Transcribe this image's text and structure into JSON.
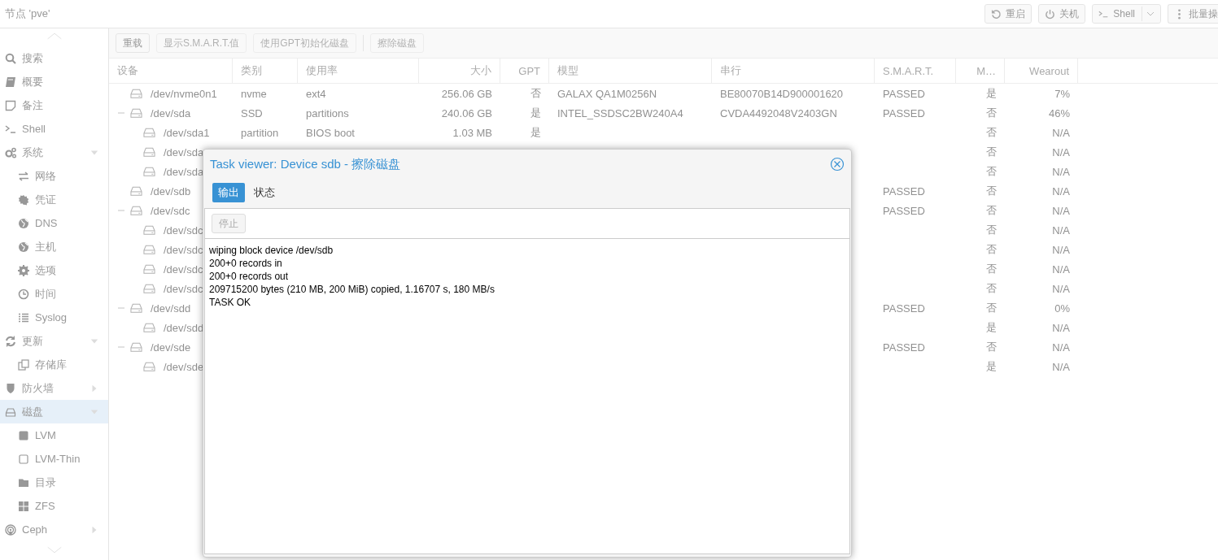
{
  "header": {
    "title": "节点 'pve'",
    "buttons": [
      {
        "label": "重启",
        "kind": "restart"
      },
      {
        "label": "关机",
        "kind": "power"
      },
      {
        "label": "Shell",
        "kind": "shell"
      },
      {
        "label": "批量操",
        "kind": "more"
      }
    ]
  },
  "sidebar": {
    "items": [
      {
        "label": "搜索",
        "selected": false
      },
      {
        "label": "概要",
        "selected": false
      },
      {
        "label": "备注",
        "selected": false
      },
      {
        "label": "Shell",
        "selected": false
      },
      {
        "label": "系统",
        "selected": false,
        "expanded": true,
        "children": [
          {
            "label": "网络",
            "selected": false
          },
          {
            "label": "凭证",
            "selected": false
          },
          {
            "label": "DNS",
            "selected": false
          },
          {
            "label": "主机",
            "selected": false
          },
          {
            "label": "选项",
            "selected": false
          },
          {
            "label": "时间",
            "selected": false
          },
          {
            "label": "Syslog",
            "selected": false
          }
        ]
      },
      {
        "label": "更新",
        "selected": false,
        "expanded": true,
        "children": [
          {
            "label": "存储库",
            "selected": false
          }
        ]
      },
      {
        "label": "防火墙",
        "selected": false,
        "expanded": false
      },
      {
        "label": "磁盘",
        "selected": true,
        "expanded": true,
        "children": [
          {
            "label": "LVM",
            "selected": false
          },
          {
            "label": "LVM-Thin",
            "selected": false
          },
          {
            "label": "目录",
            "selected": false
          },
          {
            "label": "ZFS",
            "selected": false
          }
        ]
      },
      {
        "label": "Ceph",
        "selected": false,
        "expanded": false
      }
    ]
  },
  "toolbar": [
    {
      "label": "重载",
      "disabled": false
    },
    {
      "label": "显示S.M.A.R.T.值",
      "disabled": true
    },
    {
      "label": "使用GPT初始化磁盘",
      "disabled": true
    },
    {
      "label": "擦除磁盘",
      "disabled": true
    }
  ],
  "table": {
    "columns": [
      "设备",
      "类别",
      "使用率",
      "大小",
      "GPT",
      "模型",
      "串行",
      "S.M.A.R.T.",
      "M…",
      "Wearout"
    ],
    "rows": [
      {
        "device": "/dev/nvme0n1",
        "type": "nvme",
        "usage": "ext4",
        "size": "256.06 GB",
        "gpt": "否",
        "model": "GALAX QA1M0256N",
        "serial": "BE80070B14D900001620",
        "smart": "PASSED",
        "mounted": "是",
        "wearout": "7%"
      },
      {
        "device": "/dev/sda",
        "type": "SSD",
        "usage": "partitions",
        "size": "240.06 GB",
        "gpt": "是",
        "model": "INTEL_SSDSC2BW240A4",
        "serial": "CVDA4492048V2403GN",
        "smart": "PASSED",
        "mounted": "否",
        "wearout": "46%",
        "expanded": true,
        "children": [
          {
            "device": "/dev/sda1",
            "type": "partition",
            "usage": "BIOS boot",
            "size": "1.03 MB",
            "gpt": "是",
            "mounted": "否",
            "wearout": "N/A"
          },
          {
            "device": "/dev/sda",
            "mounted": "否",
            "wearout": "N/A"
          },
          {
            "device": "/dev/sda",
            "mounted": "否",
            "wearout": "N/A"
          }
        ]
      },
      {
        "device": "/dev/sdb",
        "smart": "PASSED",
        "mounted": "否",
        "wearout": "N/A"
      },
      {
        "device": "/dev/sdc",
        "smart": "PASSED",
        "mounted": "否",
        "wearout": "N/A",
        "expanded": true,
        "children": [
          {
            "device": "/dev/sdc",
            "mounted": "否",
            "wearout": "N/A"
          },
          {
            "device": "/dev/sdc",
            "mounted": "否",
            "wearout": "N/A"
          },
          {
            "device": "/dev/sdc",
            "mounted": "否",
            "wearout": "N/A"
          },
          {
            "device": "/dev/sdc",
            "mounted": "否",
            "wearout": "N/A"
          }
        ]
      },
      {
        "device": "/dev/sdd",
        "smart": "PASSED",
        "mounted": "否",
        "wearout": "0%",
        "expanded": true,
        "children": [
          {
            "device": "/dev/sdd",
            "mounted": "是",
            "wearout": "N/A"
          }
        ]
      },
      {
        "device": "/dev/sde",
        "smart": "PASSED",
        "mounted": "否",
        "wearout": "N/A",
        "expanded": true,
        "children": [
          {
            "device": "/dev/sde",
            "mounted": "是",
            "wearout": "N/A"
          }
        ]
      }
    ]
  },
  "dialog": {
    "title": "Task viewer: Device sdb - 擦除磁盘",
    "tabs": [
      {
        "label": "输出",
        "selected": true
      },
      {
        "label": "状态",
        "selected": false
      }
    ],
    "stop_button": {
      "label": "停止",
      "disabled": true
    },
    "log": [
      "wiping block device /dev/sdb",
      "200+0 records in",
      "200+0 records out",
      "209715200 bytes (210 MB, 200 MiB) copied, 1.16707 s, 180 MB/s",
      "TASK OK"
    ]
  }
}
